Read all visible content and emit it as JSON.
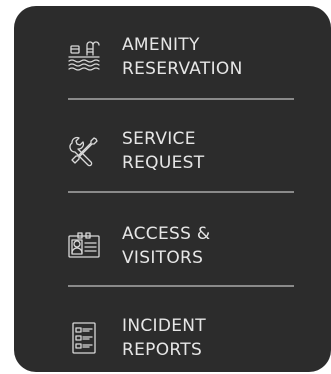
{
  "menu": {
    "items": [
      {
        "icon": "pool-icon",
        "line1": "AMENITY",
        "line2": "RESERVATION"
      },
      {
        "icon": "tools-icon",
        "line1": "SERVICE",
        "line2": "REQUEST"
      },
      {
        "icon": "id-badge-icon",
        "line1": "ACCESS &",
        "line2": "VISITORS"
      },
      {
        "icon": "report-list-icon",
        "line1": "INCIDENT",
        "line2": "REPORTS"
      }
    ]
  },
  "colors": {
    "panel_background": "#2c2c2c",
    "text": "#e6e6e6",
    "divider": "#8a8a8a"
  }
}
